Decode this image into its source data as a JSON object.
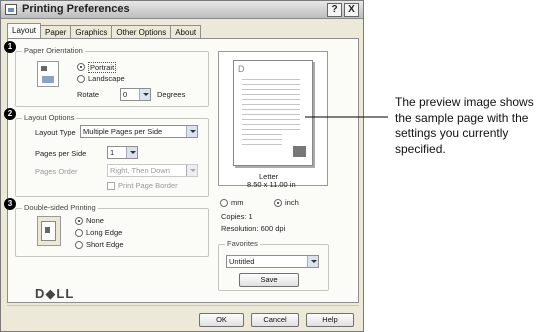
{
  "window": {
    "title": "Printing Preferences",
    "help_label": "?",
    "close_label": "X"
  },
  "tabs": [
    "Layout",
    "Paper",
    "Graphics",
    "Other Options",
    "About"
  ],
  "badges": [
    "1",
    "2",
    "3"
  ],
  "orientation": {
    "group_label": "Paper Orientation",
    "portrait_label": "Portrait",
    "landscape_label": "Landscape",
    "rotate_label": "Rotate",
    "rotate_value": "0",
    "degrees_label": "Degrees",
    "selected": "portrait"
  },
  "layout_options": {
    "group_label": "Layout Options",
    "layout_type_label": "Layout Type",
    "layout_type_value": "Multiple Pages per Side",
    "pages_per_side_label": "Pages per Side",
    "pages_per_side_value": "1",
    "pages_order_label": "Pages Order",
    "pages_order_value": "Right, Then Down",
    "print_border_label": "Print Page Border"
  },
  "duplex": {
    "group_label": "Double-sided Printing",
    "none_label": "None",
    "long_edge_label": "Long Edge",
    "short_edge_label": "Short Edge",
    "selected": "none"
  },
  "preview": {
    "paper_name": "Letter",
    "paper_size": "8.50 x 11.00 in",
    "mm_label": "mm",
    "inch_label": "inch",
    "unit_selected": "inch",
    "copies_text": "Copies: 1",
    "resolution_text": "Resolution: 600 dpi",
    "page_letter": "D"
  },
  "favorites": {
    "group_label": "Favorites",
    "value": "Untitled",
    "save_label": "Save"
  },
  "brand": "D◆LL",
  "footer": {
    "ok_label": "OK",
    "cancel_label": "Cancel",
    "help_label": "Help"
  },
  "callout_text": "The preview image shows the sample page with the settings you currently specified."
}
